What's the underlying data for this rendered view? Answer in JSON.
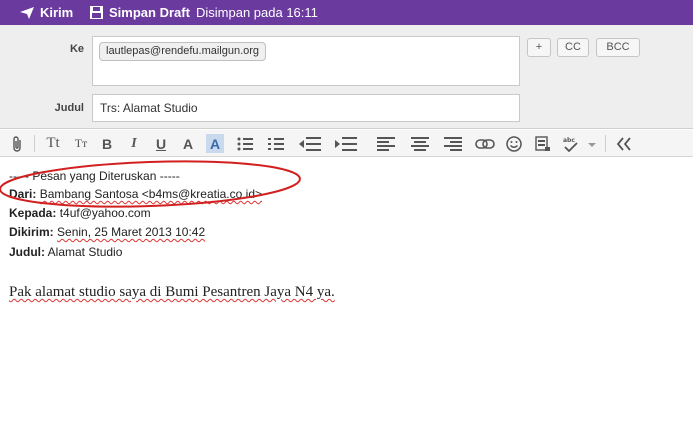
{
  "toolbar": {
    "send_label": "Kirim",
    "save_draft_label": "Simpan Draft",
    "status": "Disimpan pada 16:11"
  },
  "header": {
    "to_label": "Ke",
    "to_recipient": "lautlepas@rendefu.mailgun.org",
    "subject_label": "Judul",
    "subject_value": "Trs: Alamat Studio",
    "add_button": "+",
    "cc_button": "CC",
    "bcc_button": "BCC"
  },
  "format_toolbar": {
    "icons": [
      "attach-icon",
      "font-size-up-icon",
      "font-size-down-icon",
      "bold-icon",
      "italic-icon",
      "underline-icon",
      "text-color-icon",
      "highlight-icon",
      "bulleted-list-icon",
      "numbered-list-icon",
      "outdent-icon",
      "indent-icon",
      "align-left-icon",
      "align-center-icon",
      "align-right-icon",
      "link-icon",
      "emoji-icon",
      "insert-image-icon",
      "spellcheck-icon",
      "collapse-icon"
    ]
  },
  "body": {
    "forward_header": "----- Pesan yang Diteruskan -----",
    "from_label": "Dari:",
    "from_value": "Bambang Santosa <b4ms@kreatia.co.id>",
    "to_label": "Kepada:",
    "to_value": "t4uf@yahoo.com",
    "sent_label": "Dikirim:",
    "sent_value": "Senin, 25 Maret 2013 10:42",
    "subject_label": "Judul:",
    "subject_value": "Alamat Studio",
    "message": "Pak alamat studio saya di Bumi Pesantren Jaya N4 ya."
  },
  "colors": {
    "topbar": "#6a3a9e",
    "annotation_circle": "#d21f1f"
  }
}
